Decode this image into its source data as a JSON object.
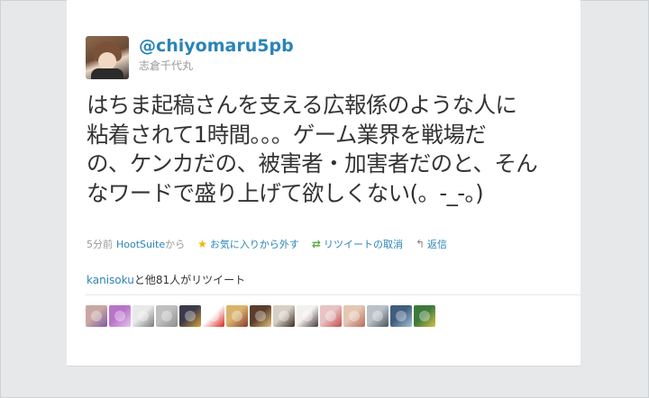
{
  "tweet": {
    "screen_name": "@chiyomaru5pb",
    "full_name": "志倉千代丸",
    "text_lines": [
      "はちま起稿さんを支える広報係のような人に",
      "粘着されて1時間。。。ゲーム業界を戦場だ",
      "の、ケンカだの、被害者・加害者だのと、そん",
      "なワードで盛り上げて欲しくない(。-_-。)"
    ],
    "time": "5分前",
    "source": "HootSuite",
    "source_suffix": "から",
    "actions": {
      "favorite_label": "お気に入りから外す",
      "retweet_label": "リツイートの取消",
      "reply_label": "返信"
    },
    "retweet_info": {
      "user": "kanisoku",
      "suffix": "と他81人がリツイート"
    }
  },
  "icons": {
    "favorite": "star-icon",
    "retweet": "retweet-icon",
    "reply": "reply-icon"
  },
  "colors": {
    "link": "#2a84b8",
    "text": "#333333",
    "muted": "#999999"
  },
  "retweeter_avatars": [
    {
      "color": "#c9a7a2",
      "accent": "#7d5aa5"
    },
    {
      "color": "#b774c9",
      "accent": "#e8c2f0"
    },
    {
      "color": "#e9e9e9",
      "accent": "#7a7a7a"
    },
    {
      "color": "#bfbfbf",
      "accent": "#8d8d8d"
    },
    {
      "color": "#3a3a4a",
      "accent": "#d8a23c"
    },
    {
      "color": "#ffffff",
      "accent": "#d7261e"
    },
    {
      "color": "#d9b36c",
      "accent": "#8a3a2a"
    },
    {
      "color": "#5a3d2b",
      "accent": "#e3c07a"
    },
    {
      "color": "#d7d0c4",
      "accent": "#3b2a22"
    },
    {
      "color": "#f3f1ef",
      "accent": "#4a3a3a"
    },
    {
      "color": "#e7c3c3",
      "accent": "#c44a4a"
    },
    {
      "color": "#e4c7b2",
      "accent": "#b86a5a"
    },
    {
      "color": "#b9c1c8",
      "accent": "#4a5660"
    },
    {
      "color": "#3f5e7f",
      "accent": "#a8c0d8"
    },
    {
      "color": "#3b7a3a",
      "accent": "#d7c04a"
    }
  ]
}
